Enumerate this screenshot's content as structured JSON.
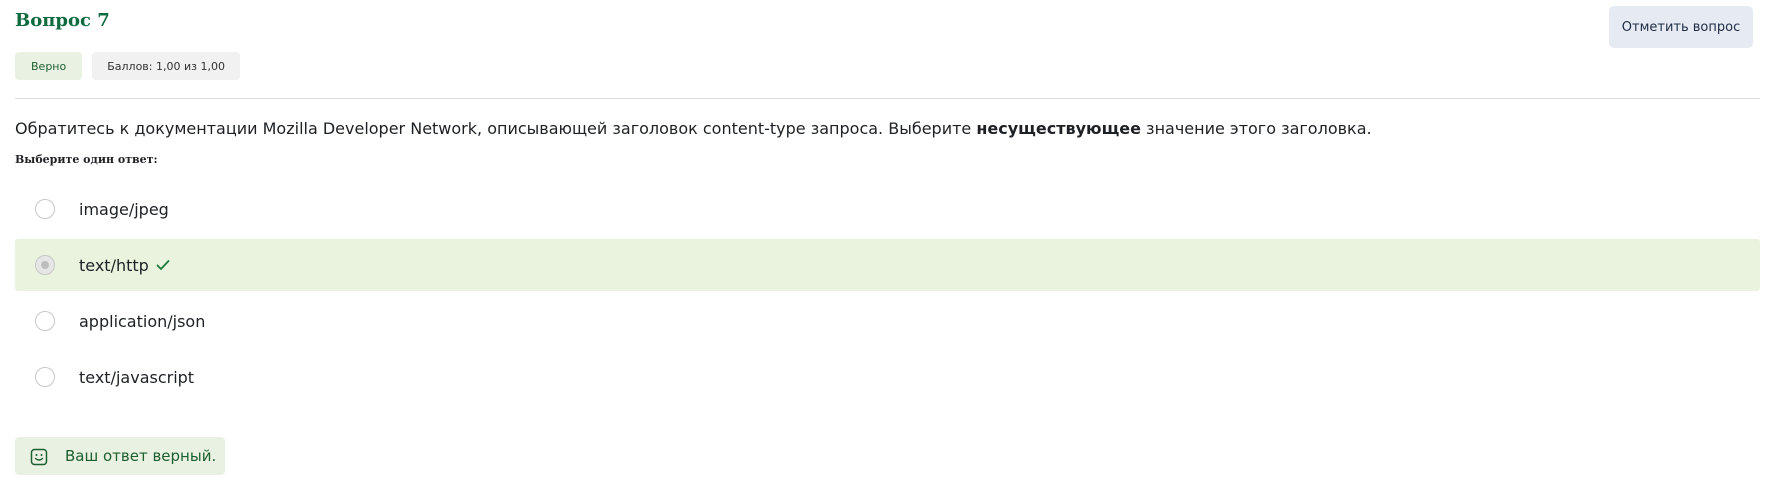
{
  "question": {
    "title": "Вопрос 7",
    "flag_label": "Отметить вопрос",
    "status": "Верно",
    "score": "Баллов: 1,00 из 1,00",
    "text_before": "Обратитесь к документации Mozilla Developer Network, описывающей заголовок content-type запроса. Выберите ",
    "text_bold": "несуществующее",
    "text_after": " значение этого заголовка.",
    "prompt": "Выберите один ответ:"
  },
  "answers": [
    {
      "label": "image/jpeg",
      "selected": false,
      "correct": false
    },
    {
      "label": "text/http",
      "selected": true,
      "correct": true
    },
    {
      "label": "application/json",
      "selected": false,
      "correct": false
    },
    {
      "label": "text/javascript",
      "selected": false,
      "correct": false
    }
  ],
  "feedback": {
    "text": "Ваш ответ верный.",
    "icon": "smile-icon"
  },
  "colors": {
    "accent_green": "#0f6b3f",
    "correct_bg": "#e9f3dd",
    "flag_bg": "#e6ebf3"
  }
}
